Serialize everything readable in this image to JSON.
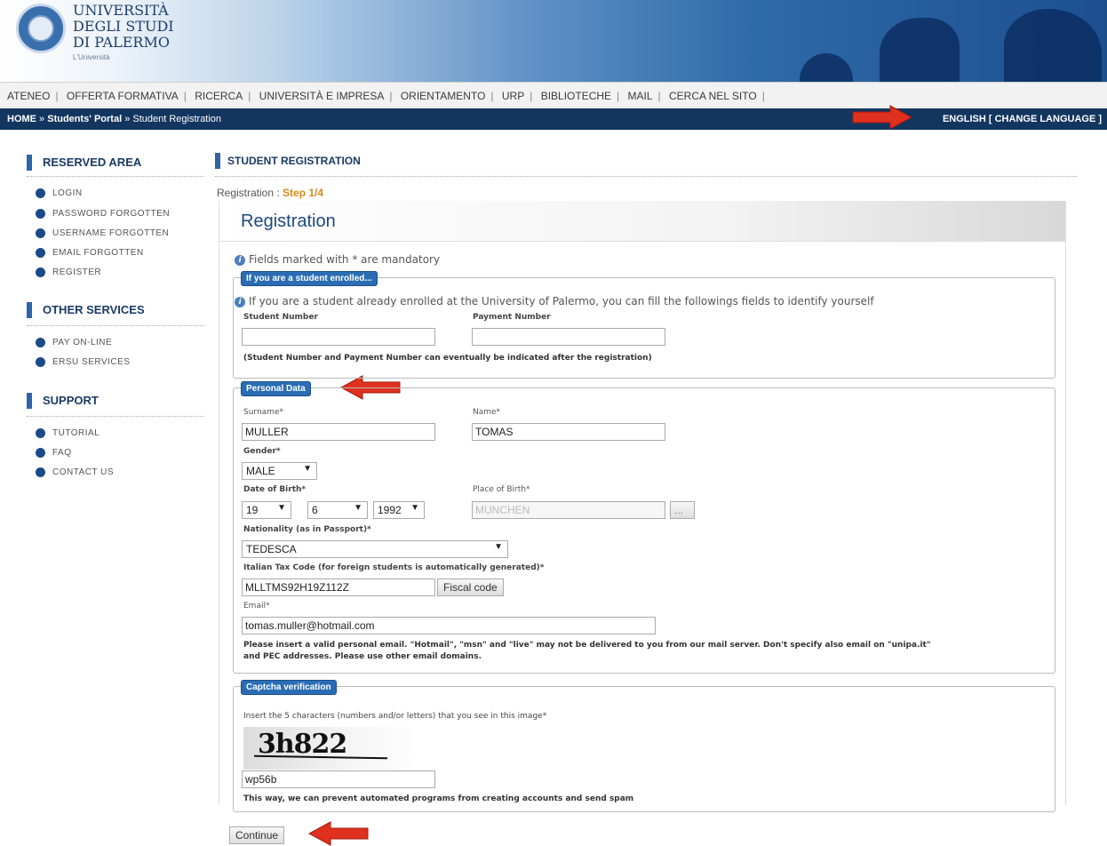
{
  "header": {
    "logo_line1": "UNIVERSITÀ",
    "logo_line2": "DEGLI STUDI",
    "logo_line3": "DI PALERMO",
    "logo_sub": "L'Università"
  },
  "topnav": {
    "items": [
      "ATENEO",
      "OFFERTA FORMATIVA",
      "RICERCA",
      "UNIVERSITÀ E IMPRESA",
      "ORIENTAMENTO",
      "URP",
      "BIBLIOTECHE",
      "MAIL",
      "CERCA NEL SITO"
    ]
  },
  "breadcrumb": {
    "home": "HOME",
    "sep1": " » ",
    "portal": "Students' Portal",
    "sep2": " » ",
    "current": "Student Registration",
    "language": "ENGLISH [ CHANGE LANGUAGE ]"
  },
  "sidebar": {
    "reserved_title": "RESERVED AREA",
    "reserved_items": [
      "LOGIN",
      "PASSWORD FORGOTTEN",
      "USERNAME FORGOTTEN",
      "EMAIL FORGOTTEN",
      "REGISTER"
    ],
    "other_title": "OTHER SERVICES",
    "other_items": [
      "PAY ON-LINE",
      "ERSU SERVICES"
    ],
    "support_title": "SUPPORT",
    "support_items": [
      "TUTORIAL",
      "FAQ",
      "CONTACT US"
    ]
  },
  "main": {
    "section_title": "STUDENT REGISTRATION",
    "step_label": "Registration : ",
    "step_value": "Step 1/4",
    "panel_title": "Registration",
    "mandatory_note": "Fields marked with * are mandatory"
  },
  "enrolled": {
    "legend": "If you are a student enrolled...",
    "info": "If you are a student already enrolled at the University of Palermo, you can fill the followings fields to identify yourself",
    "student_number_label": "Student Number",
    "student_number_value": "",
    "payment_number_label": "Payment Number",
    "payment_number_value": "",
    "note": "(Student Number and Payment Number can eventually be indicated after the registration)"
  },
  "personal": {
    "legend": "Personal Data",
    "surname_label": "Surname*",
    "surname_value": "MULLER",
    "name_label": "Name*",
    "name_value": "TOMAS",
    "gender_label": "Gender*",
    "gender_value": "MALE",
    "dob_label": "Date of Birth*",
    "dob_day": "19",
    "dob_month": "6",
    "dob_year": "1992",
    "pob_label": "Place of Birth*",
    "pob_value": "MUNCHEN",
    "pob_button": "...",
    "nationality_label": "Nationality (as in Passport)*",
    "nationality_value": "TEDESCA",
    "tax_label": "Italian Tax Code (for foreign students is automatically generated)*",
    "tax_value": "MLLTMS92H19Z112Z",
    "fiscal_button": "Fiscal code",
    "email_label": "Email*",
    "email_value": "tomas.muller@hotmail.com",
    "email_note1": "Please insert a valid personal email. \"Hotmail\", \"msn\" and \"live\" may not be delivered to you from our mail server. Don't specify also email on \"unipa.it\"",
    "email_note2": "and PEC addresses. Please use other email domains."
  },
  "captcha": {
    "legend": "Captcha verification",
    "instruction": "Insert the 5 characters (numbers and/or letters) that you see in this image*",
    "image_text": "3h822",
    "input_value": "wp56b",
    "note": "This way, we can prevent automated programs from creating accounts and send spam"
  },
  "actions": {
    "continue_label": "Continue"
  },
  "colors": {
    "nav_dark": "#12365f",
    "accent_blue": "#2a6db5",
    "arrow_red": "#e0301e",
    "step_orange": "#d98a1a"
  }
}
